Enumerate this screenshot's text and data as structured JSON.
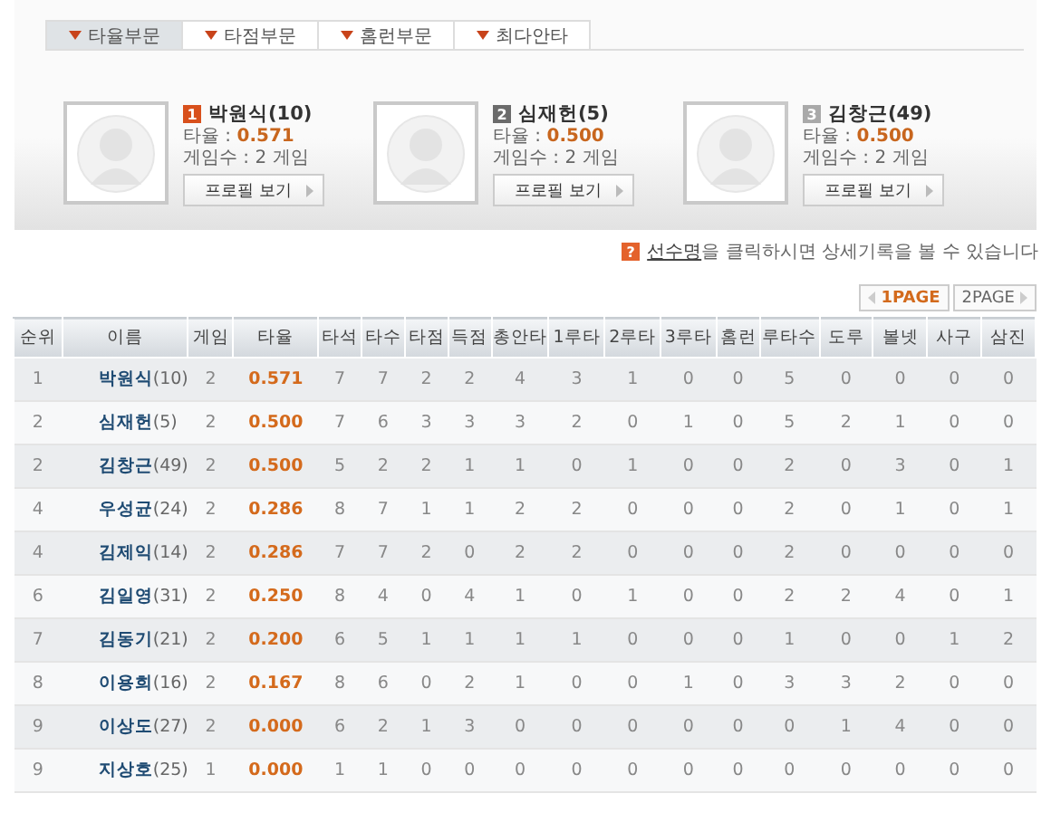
{
  "tabs": [
    {
      "label": "타율부문",
      "selected": true
    },
    {
      "label": "타점부문",
      "selected": false
    },
    {
      "label": "홈런부문",
      "selected": false
    },
    {
      "label": "최다안타",
      "selected": false
    }
  ],
  "leaders": [
    {
      "rank": "1",
      "color": "#d8501c",
      "name": "박원식(10)",
      "stat_label": "타율 :",
      "stat_value": "0.571",
      "games_label": "게임수 : 2 게임",
      "button": "프로필 보기"
    },
    {
      "rank": "2",
      "color": "#6b6b6b",
      "name": "심재헌(5)",
      "stat_label": "타율 :",
      "stat_value": "0.500",
      "games_label": "게임수 : 2 게임",
      "button": "프로필 보기"
    },
    {
      "rank": "3",
      "color": "#a9a9a9",
      "name": "김창근(49)",
      "stat_label": "타율 :",
      "stat_value": "0.500",
      "games_label": "게임수 : 2 게임",
      "button": "프로필 보기"
    }
  ],
  "notice": {
    "icon": "?",
    "link": "선수명",
    "text": "을 클릭하시면 상세기록을 볼 수 있습니다"
  },
  "pages": [
    {
      "label": "1PAGE",
      "selected": true
    },
    {
      "label": "2PAGE",
      "selected": false
    }
  ],
  "table": {
    "columns": [
      "순위",
      "이름",
      "게임",
      "타율",
      "타석",
      "타수",
      "타점",
      "득점",
      "총안타",
      "1루타",
      "2루타",
      "3루타",
      "홈런",
      "루타수",
      "도루",
      "볼넷",
      "사구",
      "삼진"
    ],
    "rows": [
      [
        "1",
        "**박원식**(10)",
        "2",
        "0.571",
        "7",
        "7",
        "2",
        "2",
        "4",
        "3",
        "1",
        "0",
        "0",
        "5",
        "0",
        "0",
        "0",
        "0"
      ],
      [
        "2",
        "**심재헌**(5)",
        "2",
        "0.500",
        "7",
        "6",
        "3",
        "3",
        "3",
        "2",
        "0",
        "1",
        "0",
        "5",
        "2",
        "1",
        "0",
        "0"
      ],
      [
        "2",
        "**김창근**(49)",
        "2",
        "0.500",
        "5",
        "2",
        "2",
        "1",
        "1",
        "0",
        "1",
        "0",
        "0",
        "2",
        "0",
        "3",
        "0",
        "1"
      ],
      [
        "4",
        "**우성균**(24)",
        "2",
        "0.286",
        "8",
        "7",
        "1",
        "1",
        "2",
        "2",
        "0",
        "0",
        "0",
        "2",
        "0",
        "1",
        "0",
        "1"
      ],
      [
        "4",
        "**김제익**(14)",
        "2",
        "0.286",
        "7",
        "7",
        "2",
        "0",
        "2",
        "2",
        "0",
        "0",
        "0",
        "2",
        "0",
        "0",
        "0",
        "0"
      ],
      [
        "6",
        "**김일영**(31)",
        "2",
        "0.250",
        "8",
        "4",
        "0",
        "4",
        "1",
        "0",
        "1",
        "0",
        "0",
        "2",
        "2",
        "4",
        "0",
        "1"
      ],
      [
        "7",
        "**김동기**(21)",
        "2",
        "0.200",
        "6",
        "5",
        "1",
        "1",
        "1",
        "1",
        "0",
        "0",
        "0",
        "1",
        "0",
        "0",
        "1",
        "2"
      ],
      [
        "8",
        "**이용희**(16)",
        "2",
        "0.167",
        "8",
        "6",
        "0",
        "2",
        "1",
        "0",
        "0",
        "1",
        "0",
        "3",
        "3",
        "2",
        "0",
        "0"
      ],
      [
        "9",
        "**이상도**(27)",
        "2",
        "0.000",
        "6",
        "2",
        "1",
        "3",
        "0",
        "0",
        "0",
        "0",
        "0",
        "0",
        "1",
        "4",
        "0",
        "0"
      ],
      [
        "9",
        "**지상호**(25)",
        "1",
        "0.000",
        "1",
        "1",
        "0",
        "0",
        "0",
        "0",
        "0",
        "0",
        "0",
        "0",
        "0",
        "0",
        "0",
        "0"
      ]
    ]
  }
}
